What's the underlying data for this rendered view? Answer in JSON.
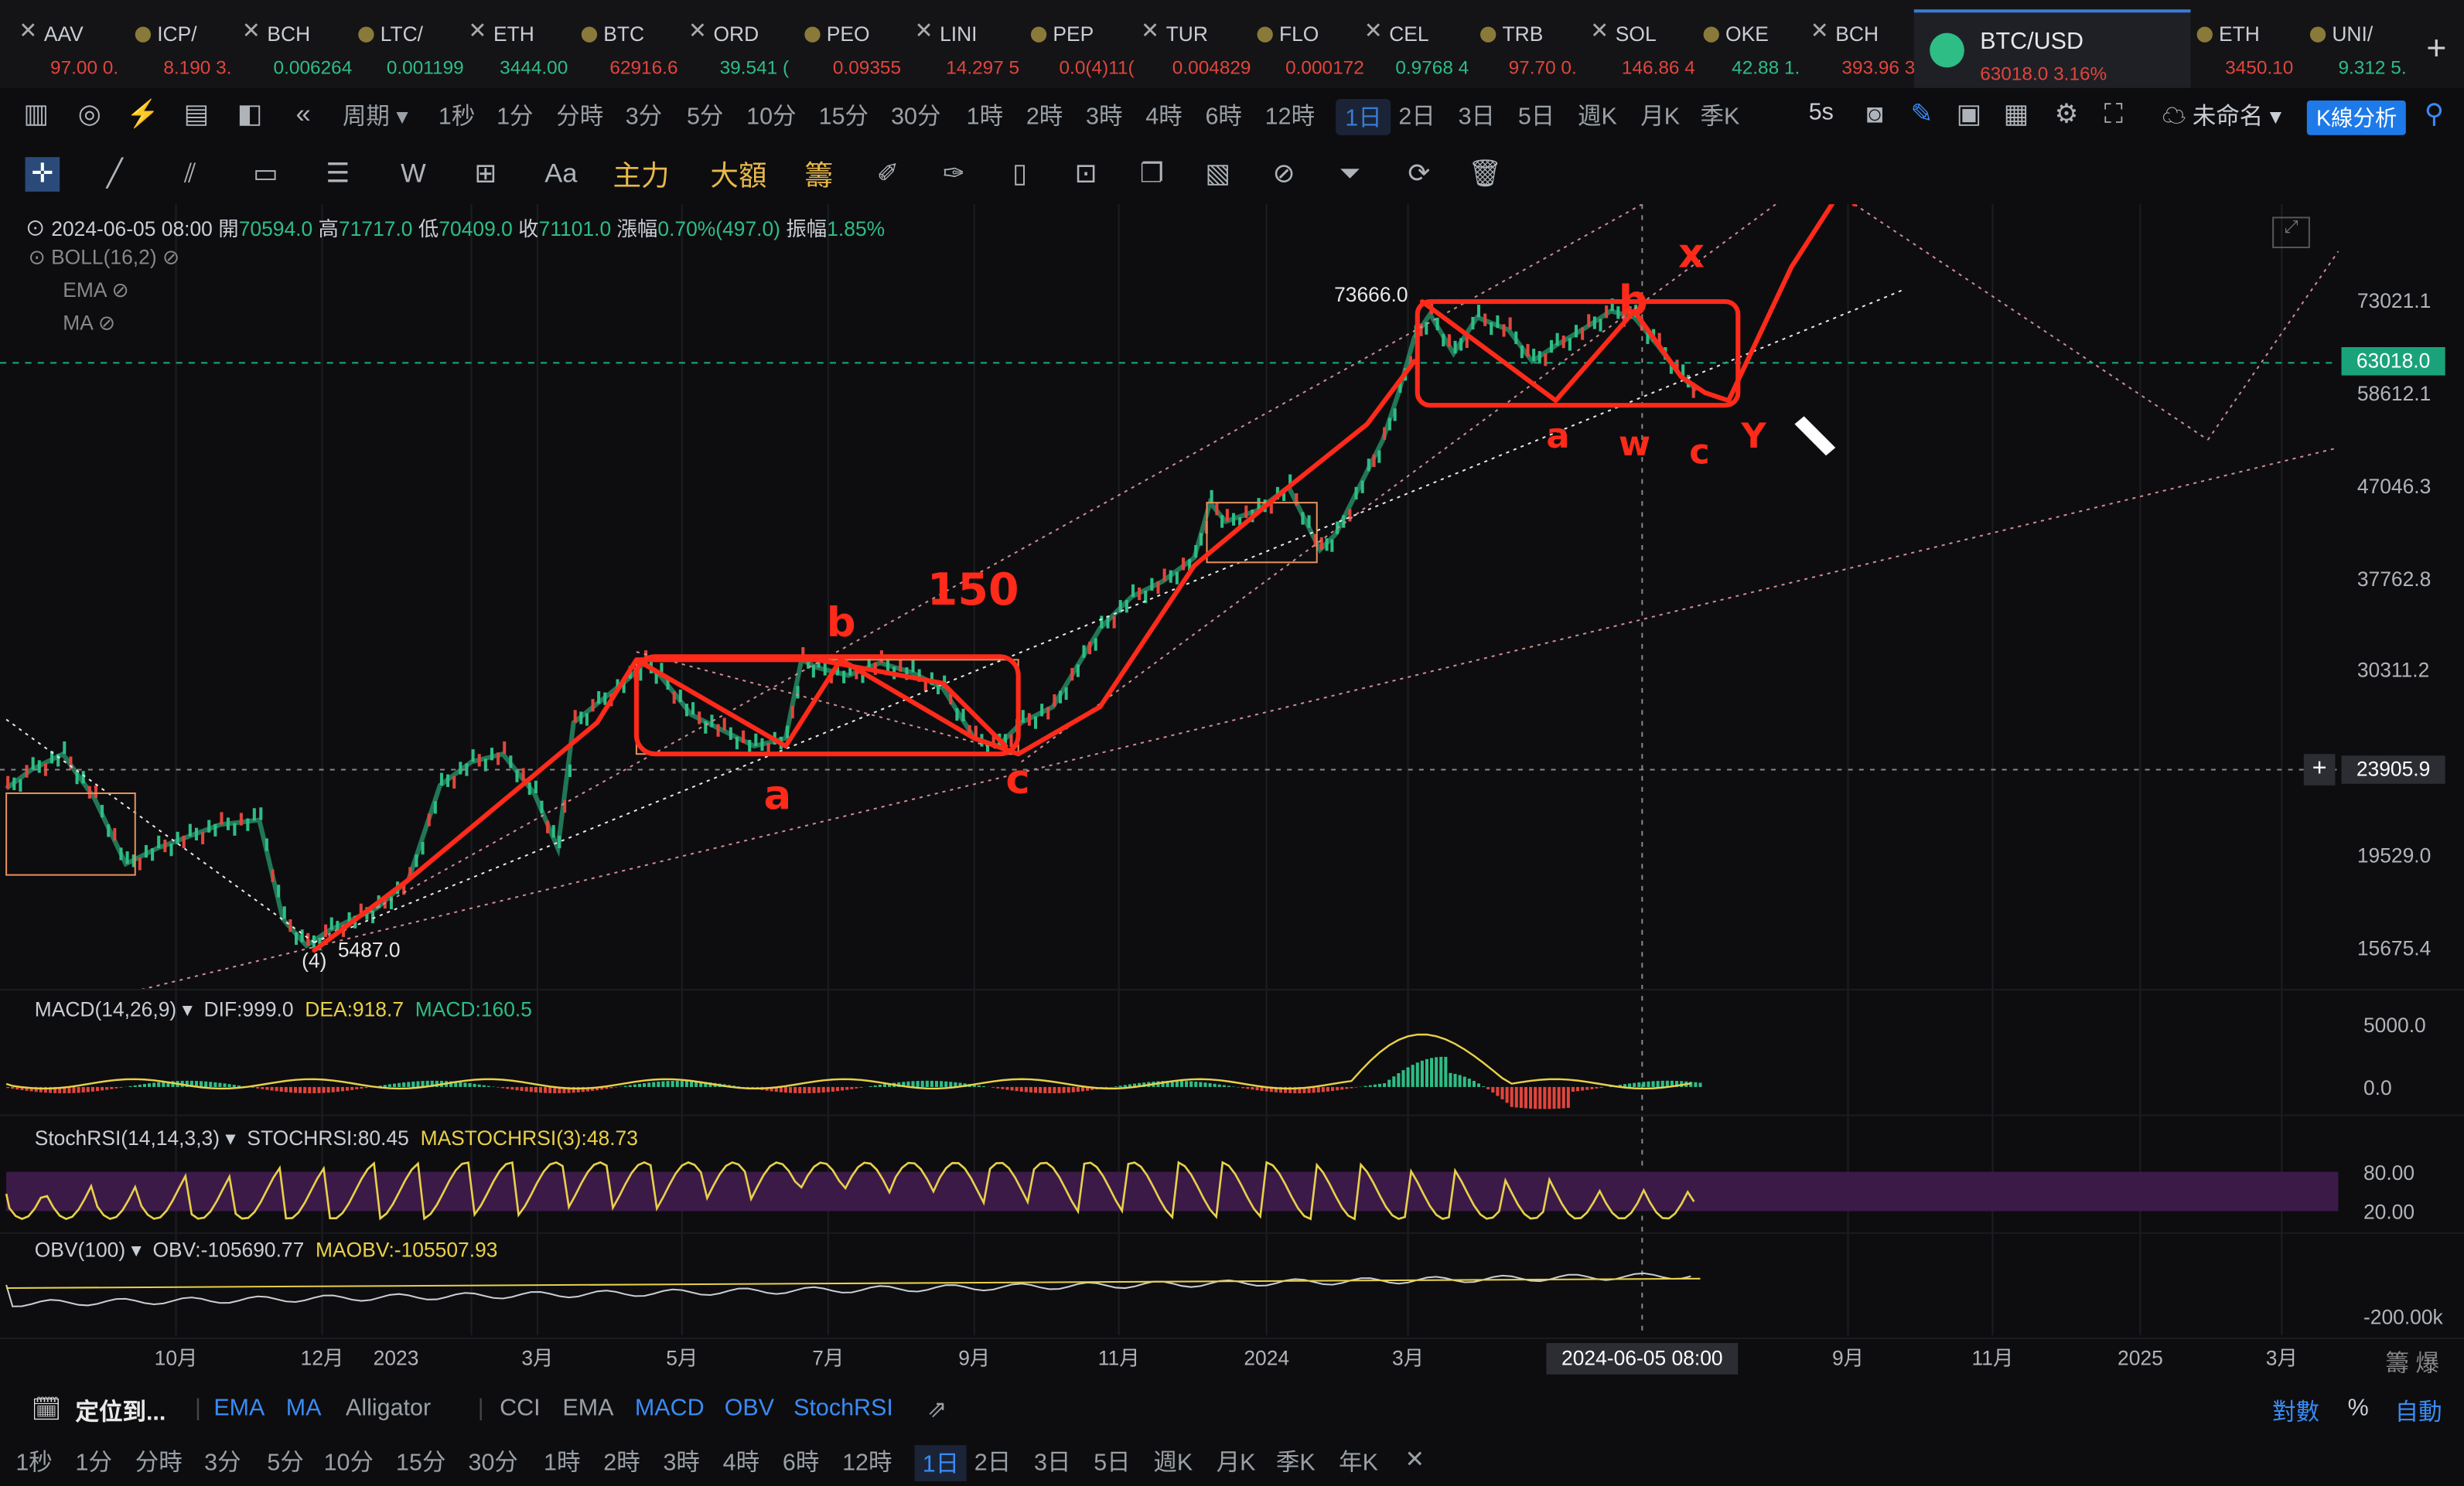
{
  "tickers": [
    {
      "sym": "AAV",
      "px": "97.00 0.",
      "up": false
    },
    {
      "sym": "ICP/",
      "px": "8.190 3.",
      "up": false
    },
    {
      "sym": "BCH",
      "px": "0.006264",
      "up": true
    },
    {
      "sym": "LTC/",
      "px": "0.001199",
      "up": true
    },
    {
      "sym": "ETH",
      "px": "3444.00",
      "up": true
    },
    {
      "sym": "BTC",
      "px": "62916.6",
      "up": false
    },
    {
      "sym": "ORD",
      "px": "39.541 (",
      "up": true
    },
    {
      "sym": "PEO",
      "px": "0.09355",
      "up": false
    },
    {
      "sym": "LINI",
      "px": "14.297 5",
      "up": false
    },
    {
      "sym": "PEP",
      "px": "0.0(4)11(",
      "up": false
    },
    {
      "sym": "TUR",
      "px": "0.004829",
      "up": false
    },
    {
      "sym": "FLO",
      "px": "0.000172",
      "up": false
    },
    {
      "sym": "CEL",
      "px": "0.9768 4",
      "up": true
    },
    {
      "sym": "TRB",
      "px": "97.70 0.",
      "up": false
    },
    {
      "sym": "SOL",
      "px": "146.86 4",
      "up": false
    },
    {
      "sym": "OKE",
      "px": "42.88 1.",
      "up": true
    },
    {
      "sym": "BCH",
      "px": "393.96 3",
      "up": false
    }
  ],
  "active_tab": {
    "sym": "BTC/USD",
    "px": "63018.0 3.16%"
  },
  "right_tickers": [
    {
      "sym": "ETH",
      "px": "3450.10",
      "up": false
    },
    {
      "sym": "UNI/",
      "px": "9.312 5.",
      "up": true
    }
  ],
  "period_bar": {
    "period_label": "周期",
    "items": [
      "1秒",
      "1分",
      "分時",
      "3分",
      "5分",
      "10分",
      "15分",
      "30分",
      "1時",
      "2時",
      "3時",
      "4時",
      "6時",
      "12時",
      "1日",
      "2日",
      "3日",
      "5日",
      "週K",
      "月K",
      "季K"
    ],
    "active": "1日",
    "interval": "5s",
    "unnamed": "未命名",
    "k_analysis": "K線分析"
  },
  "draw_bar": {
    "labels": [
      "主力",
      "大額",
      "籌"
    ]
  },
  "ohlc": {
    "date": "2024-06-05 08:00",
    "open_lbl": "開",
    "open": "70594.0",
    "high_lbl": "高",
    "high": "71717.0",
    "low_lbl": "低",
    "low": "70409.0",
    "close_lbl": "收",
    "close": "71101.0",
    "chg_lbl": "漲幅",
    "chg": "0.70%(497.0)",
    "amp_lbl": "振幅",
    "amp": "1.85%"
  },
  "indicators": {
    "boll": "BOLL(16,2)",
    "ema": "EMA",
    "ma": "MA"
  },
  "macd": {
    "name": "MACD(14,26,9)",
    "dif": "DIF:999.0",
    "dea": "DEA:918.7",
    "macd": "MACD:160.5"
  },
  "stochrsi": {
    "name": "StochRSI(14,14,3,3)",
    "k": "STOCHRSI:80.45",
    "d": "MASTOCHRSI(3):48.73"
  },
  "obv": {
    "name": "OBV(100)",
    "obv": "OBV:-105690.77",
    "ma": "MAOBV:-105507.93"
  },
  "price_axis": [
    "73021.1",
    "58612.1",
    "47046.3",
    "37762.8",
    "30311.2",
    "19529.0",
    "15675.4"
  ],
  "current_price": "63018.0",
  "crosshair_price": "23905.9",
  "annotations": {
    "high": "73666.0",
    "low": "5487.0",
    "wave4": "(4)"
  },
  "macd_axis": [
    "5000.0",
    "0.0"
  ],
  "stoch_axis": [
    "80.00",
    "20.00"
  ],
  "obv_axis": [
    "-200.00k"
  ],
  "time_axis": [
    "10月",
    "12月",
    "2023",
    "3月",
    "5月",
    "7月",
    "9月",
    "11月",
    "2024",
    "3月",
    "9月",
    "11月",
    "2025",
    "3月"
  ],
  "crosshair_time": "2024-06-05 08:00",
  "corner": "籌 爆",
  "bottom_bar1": {
    "locate": "定位到...",
    "items": [
      "EMA",
      "MA",
      "Alligator",
      "CCI",
      "EMA",
      "MACD",
      "OBV",
      "StochRSI"
    ],
    "right": [
      "對數",
      "%",
      "自動"
    ]
  },
  "bottom_bar2": {
    "items": [
      "1秒",
      "1分",
      "分時",
      "3分",
      "5分",
      "10分",
      "15分",
      "30分",
      "1時",
      "2時",
      "3時",
      "4時",
      "6時",
      "12時",
      "1日",
      "2日",
      "3日",
      "5日",
      "週K",
      "月K",
      "季K",
      "年K"
    ],
    "active": "1日"
  },
  "colors": {
    "up": "#2ebd85",
    "down": "#e0453c",
    "accent": "#3a7bd5",
    "drawing": "#ff2a1a"
  }
}
